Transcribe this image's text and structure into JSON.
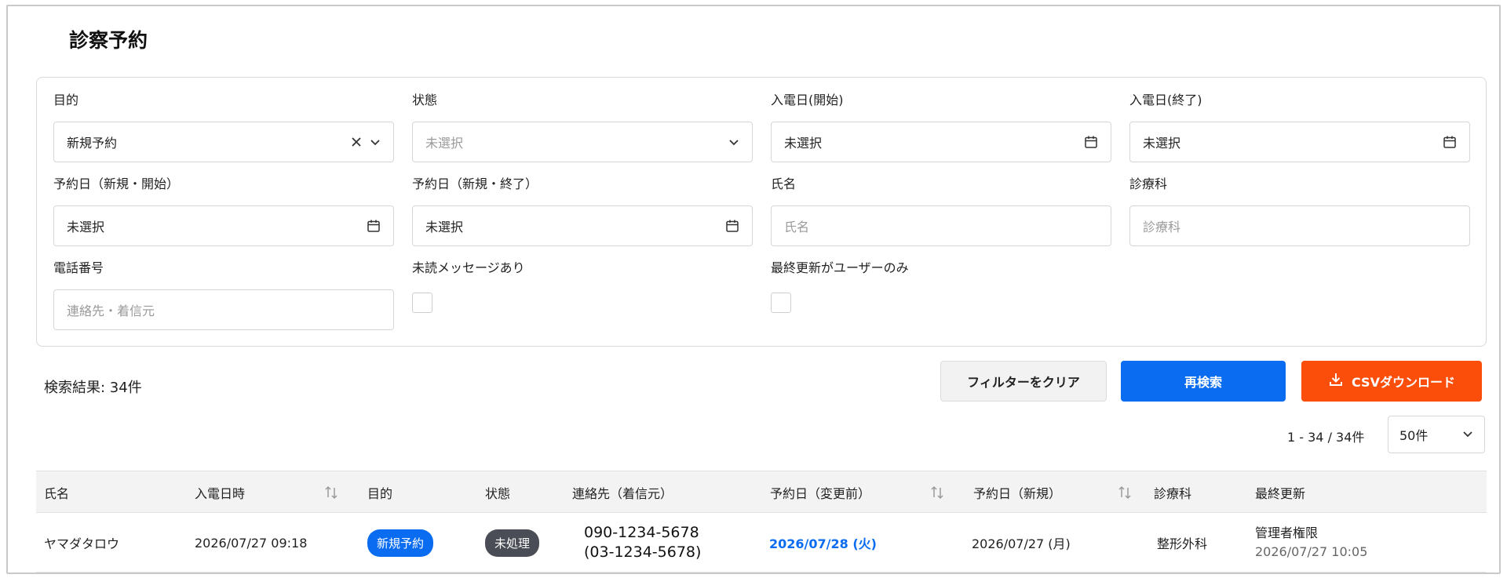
{
  "page": {
    "title": "診察予約"
  },
  "filters": {
    "purpose": {
      "label": "目的",
      "value": "新規予約"
    },
    "status": {
      "label": "状態",
      "placeholder": "未選択"
    },
    "call_start": {
      "label": "入電日(開始)",
      "value": "未選択"
    },
    "call_end": {
      "label": "入電日(終了)",
      "value": "未選択"
    },
    "booking_start": {
      "label": "予約日（新規・開始）",
      "value": "未選択"
    },
    "booking_end": {
      "label": "予約日（新規・終了）",
      "value": "未選択"
    },
    "name": {
      "label": "氏名",
      "placeholder": "氏名"
    },
    "department": {
      "label": "診療科",
      "placeholder": "診療科"
    },
    "phone": {
      "label": "電話番号",
      "placeholder": "連絡先・着信元"
    },
    "unread": {
      "label": "未読メッセージあり"
    },
    "user_only": {
      "label": "最終更新がユーザーのみ"
    }
  },
  "results": {
    "count_text": "検索結果: 34件",
    "clear_label": "フィルターをクリア",
    "search_label": "再検索",
    "csv_label": "CSVダウンロード",
    "range_text": "1 - 34 / 34件",
    "per_page": "50件"
  },
  "table": {
    "headers": {
      "name": "氏名",
      "call_time": "入電日時",
      "purpose": "目的",
      "status": "状態",
      "contact": "連絡先（着信元）",
      "booking_before": "予約日（変更前）",
      "booking_new": "予約日（新規）",
      "department": "診療科",
      "updated": "最終更新"
    },
    "rows": [
      {
        "name": "ヤマダタロウ",
        "call_time": "2026/07/27 09:18",
        "purpose": "新規予約",
        "status": "未処理",
        "contact": "090-1234-5678",
        "caller": "(03-1234-5678)",
        "booking_before": "2026/07/28 (火)",
        "booking_new": "2026/07/27 (月)",
        "department": "整形外科",
        "updated_by": "管理者権限",
        "updated_at": "2026/07/27 10:05"
      }
    ]
  },
  "colors": {
    "primary": "#0a6cf1",
    "accent": "#fb4e0b",
    "status_badge": "#4a4d55"
  },
  "icons": [
    "clear-icon",
    "chevron-down-icon",
    "calendar-icon",
    "sort-icon",
    "download-icon"
  ]
}
